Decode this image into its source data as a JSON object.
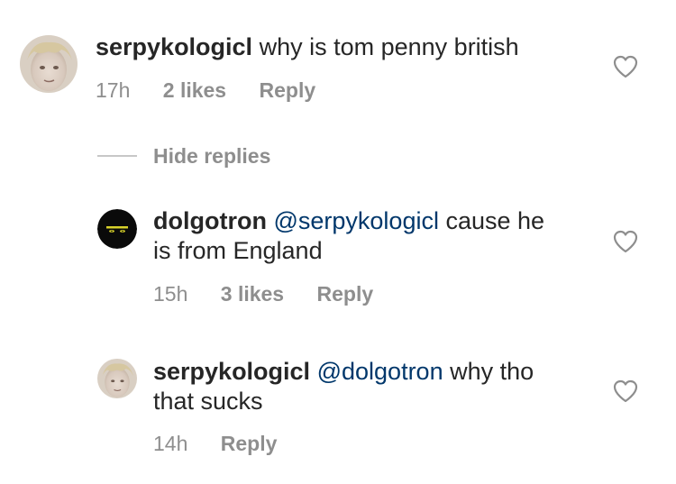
{
  "comments": [
    {
      "username": "serpykologicl",
      "text": " why is tom penny british",
      "time": "17h",
      "likes": "2 likes",
      "reply": "Reply"
    }
  ],
  "hide_replies": "Hide replies",
  "replies": [
    {
      "username": "dolgotron",
      "mention": "@serpykologicl",
      "text_line1": " cause he",
      "text_line2": "is from England",
      "time": "15h",
      "likes": "3 likes",
      "reply": "Reply"
    },
    {
      "username": "serpykologicl",
      "mention": "@dolgotron",
      "text_line1": " why tho",
      "text_line2": "that sucks",
      "time": "14h",
      "reply": "Reply"
    }
  ],
  "colors": {
    "text": "#262626",
    "meta": "#8e8e8e",
    "mention": "#00376b",
    "heart": "#8e8e8e"
  },
  "icons": {
    "like": "heart-outline-icon"
  }
}
